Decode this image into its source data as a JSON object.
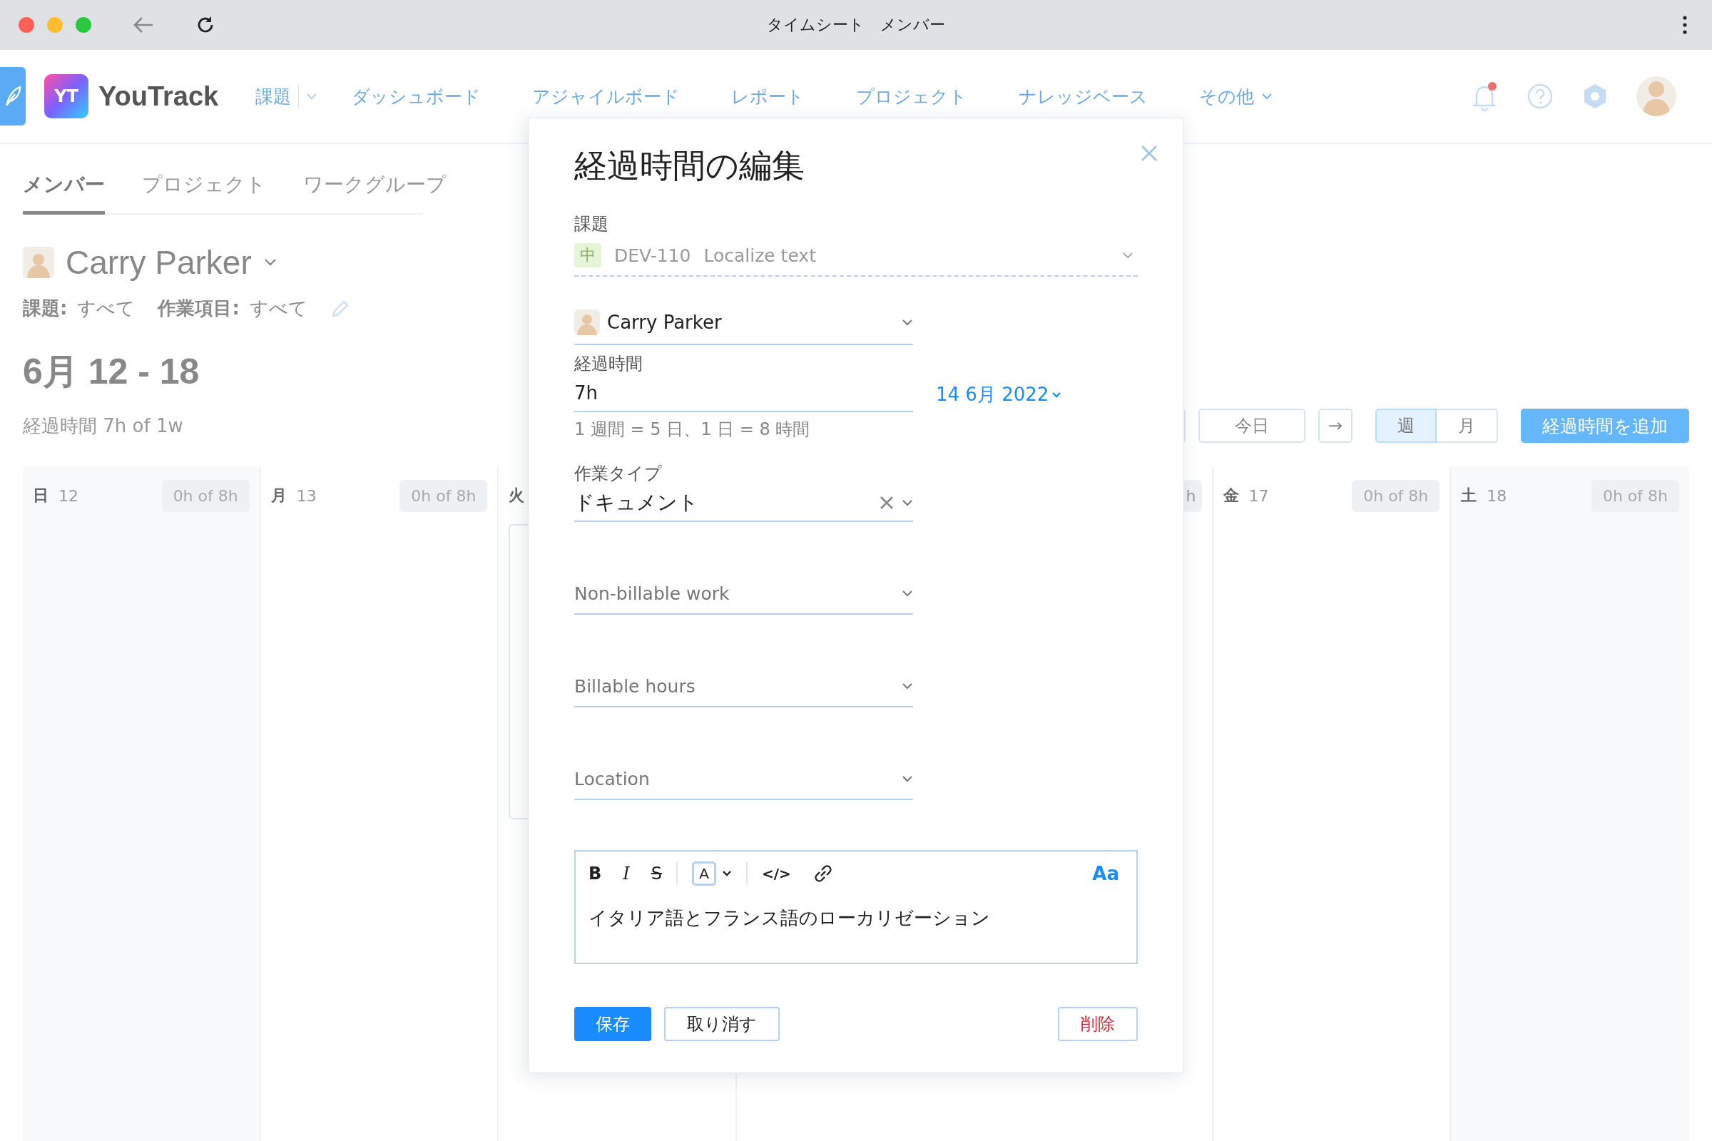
{
  "browser": {
    "title": "タイムシート　メンバー"
  },
  "header": {
    "logo_badge": "YT",
    "logo": "YouTrack",
    "unread_notifications": true,
    "nav": [
      {
        "label": "課題",
        "kind": "split"
      },
      {
        "label": "ダッシュボード",
        "kind": "link"
      },
      {
        "label": "アジャイルボード",
        "kind": "link"
      },
      {
        "label": "レポート",
        "kind": "link"
      },
      {
        "label": "プロジェクト",
        "kind": "link"
      },
      {
        "label": "ナレッジベース",
        "kind": "link"
      },
      {
        "label": "その他",
        "kind": "menu"
      }
    ]
  },
  "tabs": [
    {
      "label": "メンバー",
      "selected": true
    },
    {
      "label": "プロジェクト",
      "selected": false
    },
    {
      "label": "ワークグループ",
      "selected": false
    }
  ],
  "user": {
    "name": "Carry Parker"
  },
  "filters": [
    {
      "label": "課題:",
      "value": "すべて"
    },
    {
      "label": "作業項目:",
      "value": "すべて"
    }
  ],
  "period": "6月 12 - 18",
  "summary": "経過時間 7h of 1w",
  "toolbar": {
    "today": "今日",
    "next": "→",
    "views": [
      {
        "label": "週",
        "selected": true
      },
      {
        "label": "月",
        "selected": false
      }
    ],
    "add": "経過時間を追加"
  },
  "calendar": {
    "days": [
      {
        "day": "日",
        "date": "12",
        "hours": "0h of 8h",
        "weekend": true,
        "entry": false
      },
      {
        "day": "月",
        "date": "13",
        "hours": "0h of 8h",
        "weekend": false,
        "entry": false
      },
      {
        "day": "火",
        "weekend": false,
        "entry": true
      },
      {
        "hours": "h",
        "weekend": false,
        "entry": false
      },
      {
        "day": "金",
        "date": "17",
        "hours": "0h of 8h",
        "weekend": false,
        "entry": false
      },
      {
        "day": "土",
        "date": "18",
        "hours": "0h of 8h",
        "weekend": true,
        "entry": false
      }
    ]
  },
  "dialog": {
    "title": "経過時間の編集",
    "issue": {
      "label": "課題",
      "priority": "中",
      "id": "DEV-110",
      "summary": "Localize text"
    },
    "author": "Carry Parker",
    "duration": {
      "label": "経過時間",
      "value": "7h",
      "hint": "1 週間 = 5 日、1 日 = 8 時間"
    },
    "date": "14 6月 2022",
    "work_type": {
      "label": "作業タイプ",
      "value": "ドキュメント"
    },
    "custom_fields": [
      {
        "placeholder": "Non-billable work"
      },
      {
        "placeholder": "Billable hours"
      },
      {
        "placeholder": "Location"
      }
    ],
    "editor": {
      "tools": [
        {
          "kind": "bold",
          "label": "B"
        },
        {
          "kind": "italic",
          "label": "I"
        },
        {
          "kind": "strike",
          "label": "S"
        },
        {
          "kind": "color",
          "label": "A"
        },
        {
          "kind": "code",
          "label": "</>"
        },
        {
          "kind": "link"
        }
      ],
      "format_toggle": "Aa",
      "text": "イタリア語とフランス語のローカリゼーション"
    },
    "buttons": [
      {
        "label": "保存",
        "kind": "primary"
      },
      {
        "label": "取り消す",
        "kind": "secondary"
      },
      {
        "label": "削除",
        "kind": "danger"
      }
    ]
  }
}
